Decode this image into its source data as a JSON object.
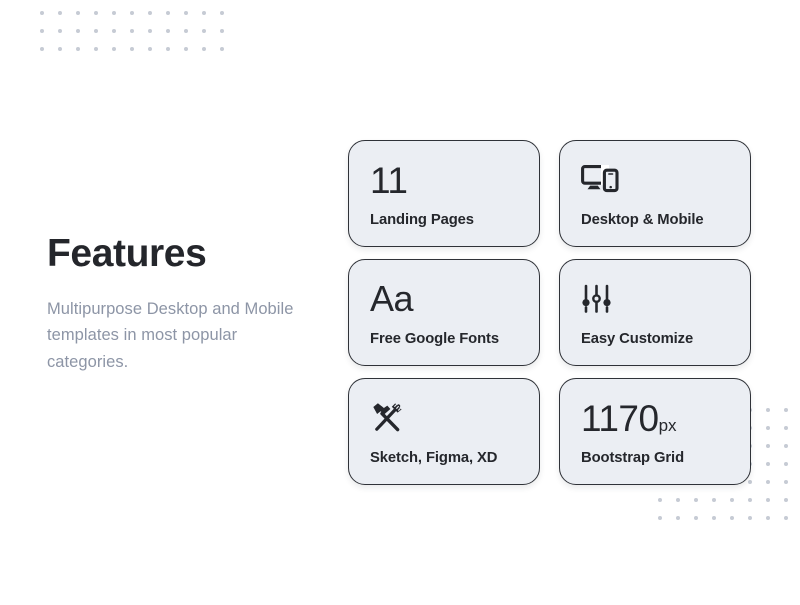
{
  "page": {
    "background_color": "#ffffff",
    "accent_dot_color": "#c6cbd4",
    "card_fill_color": "#ebeef3",
    "card_border_color": "#2f3238",
    "text_color": "#25272c",
    "muted_text_color": "#8d95a6"
  },
  "intro": {
    "title": "Features",
    "subtitle": "Multipurpose Desktop and Mobile templates in most popular categories."
  },
  "decor": {
    "dots_top_left": {
      "columns": 11,
      "rows": 3
    },
    "dots_bottom_right": {
      "columns": 8,
      "rows": 7
    }
  },
  "features": [
    {
      "visual_kind": "number",
      "value": "11",
      "unit": "",
      "icon": "",
      "label": "Landing Pages"
    },
    {
      "visual_kind": "icon",
      "value": "",
      "unit": "",
      "icon": "desktop-mobile-icon",
      "label": "Desktop & Mobile"
    },
    {
      "visual_kind": "glyph",
      "value": "Aa",
      "unit": "",
      "icon": "",
      "label": "Free Google Fonts"
    },
    {
      "visual_kind": "icon",
      "value": "",
      "unit": "",
      "icon": "sliders-icon",
      "label": "Easy Customize"
    },
    {
      "visual_kind": "icon",
      "value": "",
      "unit": "",
      "icon": "hammer-wrench-icon",
      "label": "Sketch, Figma, XD"
    },
    {
      "visual_kind": "number",
      "value": "1170",
      "unit": "px",
      "icon": "",
      "label": "Bootstrap Grid"
    }
  ]
}
